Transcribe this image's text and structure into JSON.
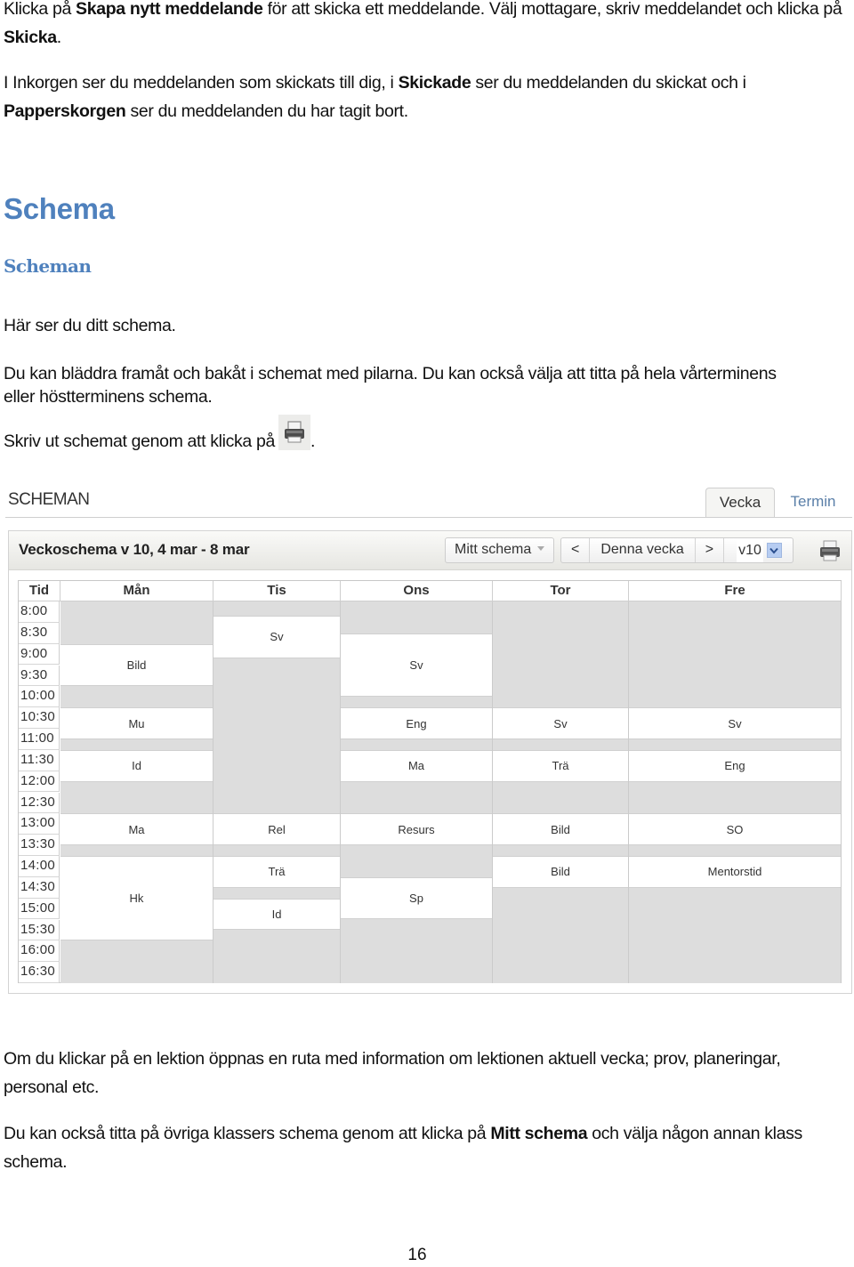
{
  "intro": {
    "p1": [
      "Klicka på ",
      "Skapa nytt meddelande",
      " för att skicka ett meddelande. Välj mottagare, skriv meddelandet och klicka på ",
      "Skicka",
      "."
    ],
    "p2": [
      "I Inkorgen ser du meddelanden som skickats till dig, i ",
      "Skickade",
      " ser du meddelanden du skickat och i ",
      "Papperskorgen",
      " ser du meddelanden du har tagit bort."
    ]
  },
  "section": {
    "heading": "Schema",
    "subheading": "Scheman",
    "p3": "Här ser du ditt schema.",
    "p4": "Du kan bläddra framåt och bakåt i schemat med pilarna. Du kan också välja att titta på hela vårterminens eller höstterminens schema.",
    "p5_before": "Skriv ut schemat genom att klicka på",
    "p5_after": ".",
    "inline_icon": "printer-icon"
  },
  "app": {
    "title": "SCHEMAN",
    "tabs": [
      {
        "label": "Vecka",
        "active": true
      },
      {
        "label": "Termin",
        "active": false
      }
    ],
    "panel_title": "Veckoschema v 10, 4 mar - 8 mar",
    "toolbar": {
      "schedule_select": "Mitt schema",
      "prev": "<",
      "today": "Denna vecka",
      "next": ">",
      "week_value": "v10",
      "print_icon": "printer-icon"
    },
    "grid": {
      "time_header": "Tid",
      "times": [
        "8:00",
        "8:30",
        "9:00",
        "9:30",
        "10:00",
        "10:30",
        "11:00",
        "11:30",
        "12:00",
        "12:30",
        "13:00",
        "13:30",
        "14:00",
        "14:30",
        "15:00",
        "15:30",
        "16:00",
        "16:30"
      ],
      "day_start_min": 480,
      "day_end_min": 1020,
      "days": [
        {
          "name": "Mån",
          "lessons": [
            {
              "subject": "Bild",
              "start": "9:00",
              "end": "10:00"
            },
            {
              "subject": "Mu",
              "start": "10:30",
              "end": "11:15"
            },
            {
              "subject": "Id",
              "start": "11:30",
              "end": "12:15"
            },
            {
              "subject": "Ma",
              "start": "13:00",
              "end": "13:45"
            },
            {
              "subject": "Hk",
              "start": "14:00",
              "end": "16:00"
            }
          ]
        },
        {
          "name": "Tis",
          "lessons": [
            {
              "subject": "Sv",
              "start": "8:20",
              "end": "9:20"
            },
            {
              "subject": "Rel",
              "start": "13:00",
              "end": "13:45"
            },
            {
              "subject": "Trä",
              "start": "14:00",
              "end": "14:45"
            },
            {
              "subject": "Id",
              "start": "15:00",
              "end": "15:45"
            }
          ]
        },
        {
          "name": "Ons",
          "lessons": [
            {
              "subject": "Sv",
              "start": "8:45",
              "end": "10:15"
            },
            {
              "subject": "Eng",
              "start": "10:30",
              "end": "11:15"
            },
            {
              "subject": "Ma",
              "start": "11:30",
              "end": "12:15"
            },
            {
              "subject": "Resurs",
              "start": "13:00",
              "end": "13:45"
            },
            {
              "subject": "Sp",
              "start": "14:30",
              "end": "15:30"
            }
          ]
        },
        {
          "name": "Tor",
          "lessons": [
            {
              "subject": "Sv",
              "start": "10:30",
              "end": "11:15"
            },
            {
              "subject": "Trä",
              "start": "11:30",
              "end": "12:15"
            },
            {
              "subject": "Bild",
              "start": "13:00",
              "end": "13:45"
            },
            {
              "subject": "Bild",
              "start": "14:00",
              "end": "14:45"
            }
          ]
        },
        {
          "name": "Fre",
          "lessons": [
            {
              "subject": "Sv",
              "start": "10:30",
              "end": "11:15"
            },
            {
              "subject": "Eng",
              "start": "11:30",
              "end": "12:15"
            },
            {
              "subject": "SO",
              "start": "13:00",
              "end": "13:45"
            },
            {
              "subject": "Mentorstid",
              "start": "14:00",
              "end": "14:45"
            }
          ]
        }
      ]
    }
  },
  "outro": {
    "p6": "Om du klickar på en lektion öppnas en ruta med information om lektionen aktuell vecka; prov, planeringar, personal etc.",
    "p7": [
      "Du kan också titta på övriga klassers schema genom att klicka på ",
      "Mitt schema",
      " och välja någon annan klass schema."
    ]
  },
  "page_number": "16",
  "colors": {
    "heading": "#4f81bd",
    "free_slot": "#dddddd",
    "lesson": "#ffffff",
    "tab_link": "#5a7fa8"
  }
}
